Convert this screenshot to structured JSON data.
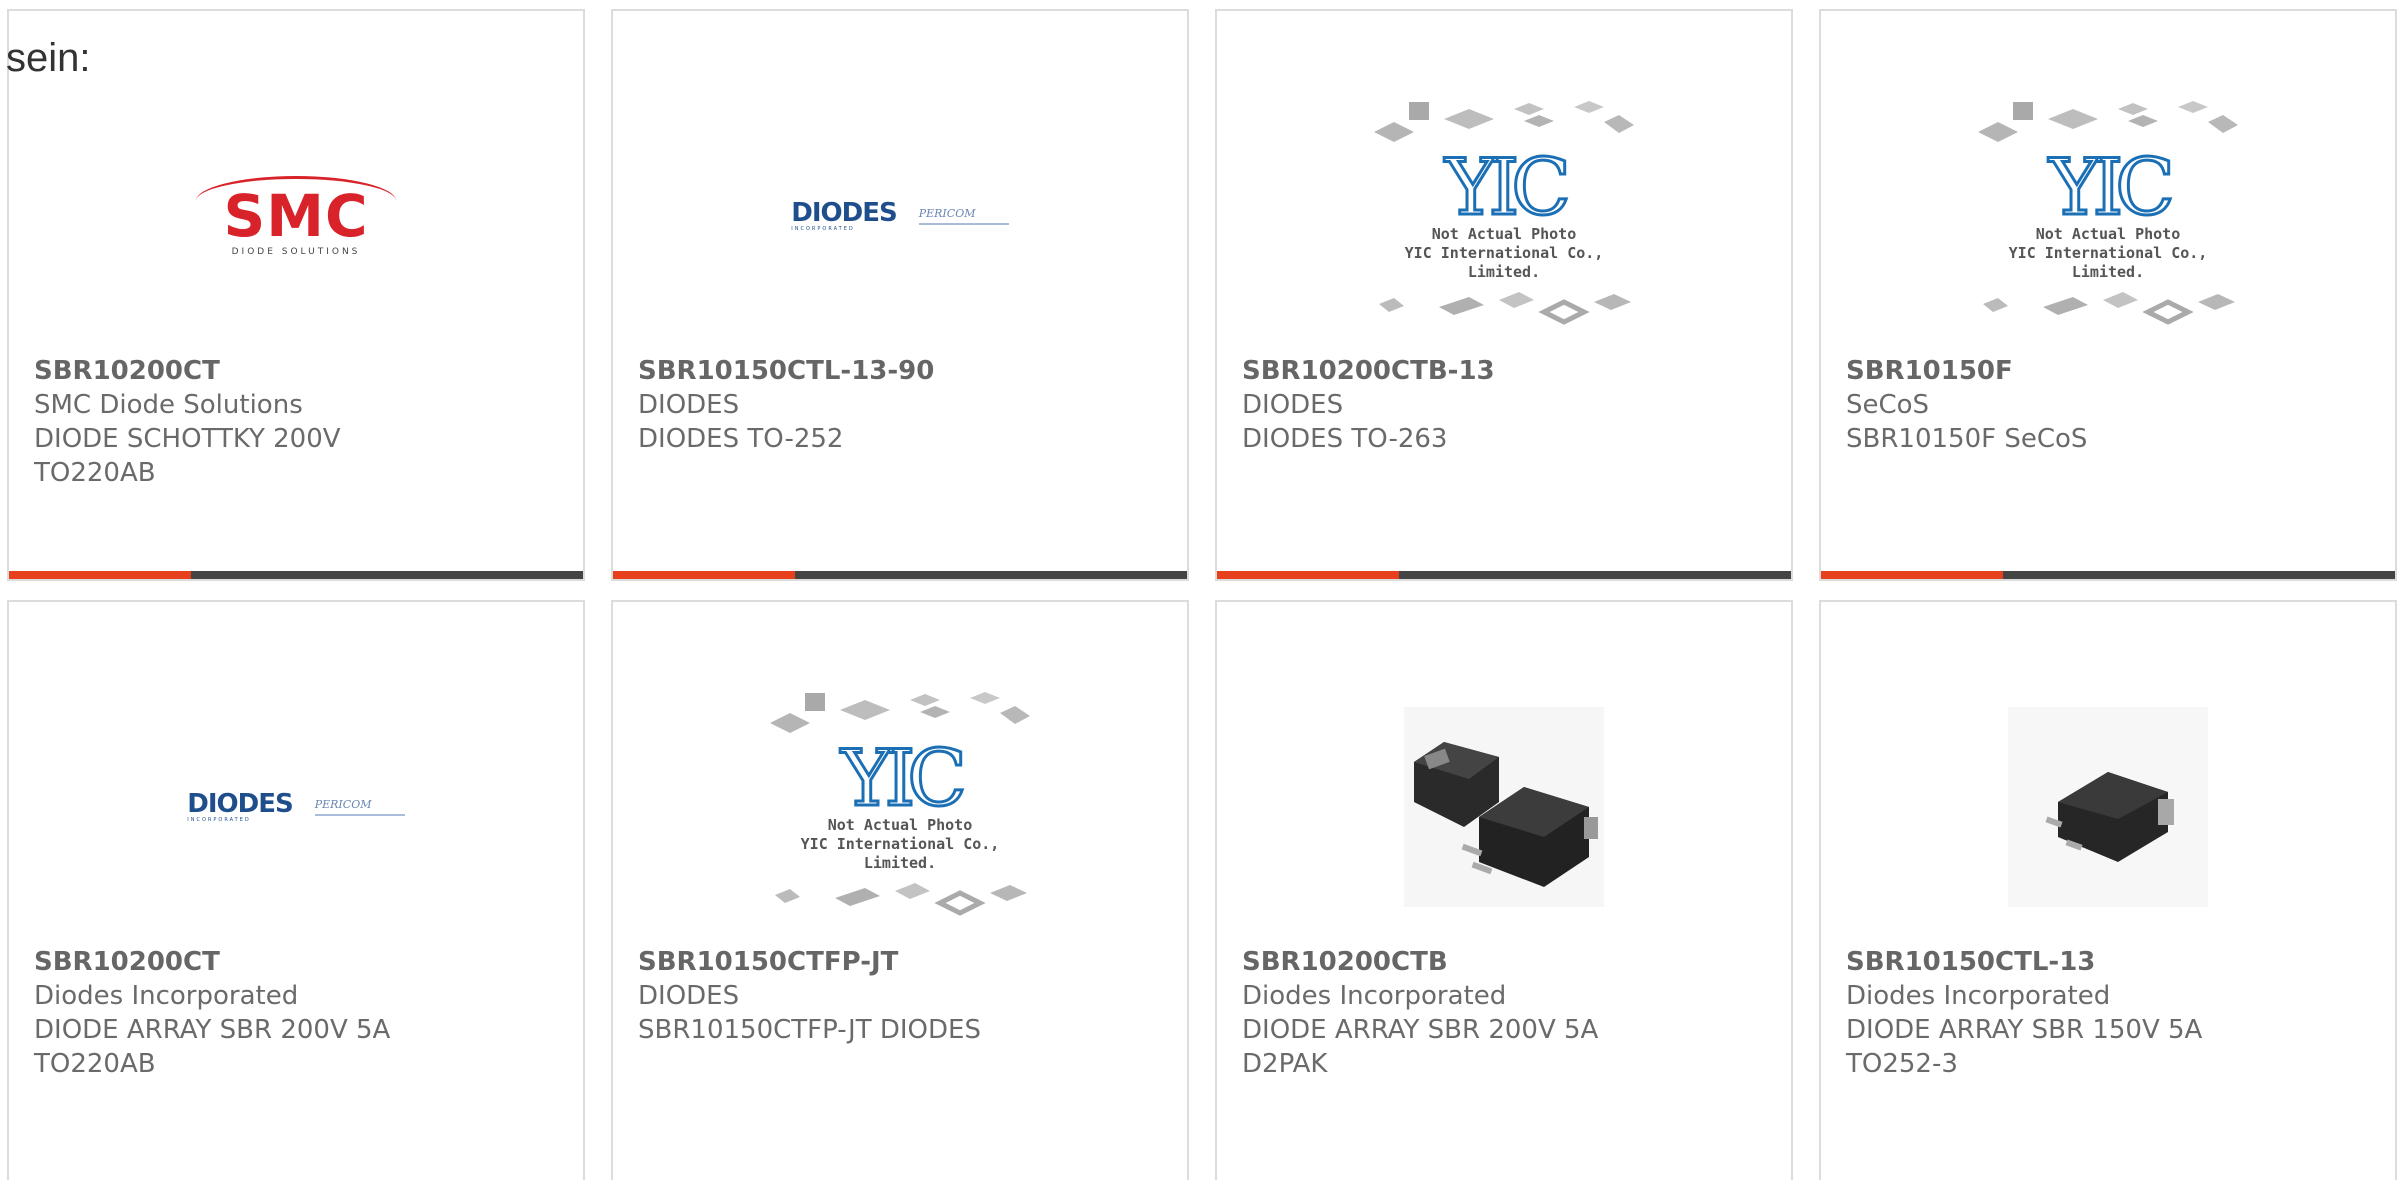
{
  "intro_text": "sein:",
  "colors": {
    "accent": "#e8401c",
    "bar": "#444444",
    "border": "#dcdcdc",
    "text": "#6a6a6a"
  },
  "logos": {
    "smc": {
      "word": "SMC",
      "sub": "DIODE SOLUTIONS"
    },
    "diodes": {
      "word": "DIODES",
      "tag": "INCORPORATED",
      "partner": "PERICOM"
    },
    "yic": {
      "mark": "YIC",
      "line1": "Not Actual Photo",
      "line2": "YIC International Co., Limited."
    }
  },
  "products": [
    {
      "part": "SBR10200CT",
      "maker": "SMC Diode Solutions",
      "desc": [
        "DIODE SCHOTTKY 200V",
        "TO220AB"
      ],
      "image": "smc-logo"
    },
    {
      "part": "SBR10150CTL-13-90",
      "maker": "DIODES",
      "desc": [
        "DIODES TO-252"
      ],
      "image": "diodes-logo"
    },
    {
      "part": "SBR10200CTB-13",
      "maker": "DIODES",
      "desc": [
        "DIODES TO-263"
      ],
      "image": "yic-placeholder"
    },
    {
      "part": "SBR10150F",
      "maker": "SeCoS",
      "desc": [
        "SBR10150F SeCoS"
      ],
      "image": "yic-placeholder"
    },
    {
      "part": "SBR10200CT",
      "maker": "Diodes Incorporated",
      "desc": [
        "DIODE ARRAY SBR 200V 5A",
        "TO220AB"
      ],
      "image": "diodes-logo"
    },
    {
      "part": "SBR10150CTFP-JT",
      "maker": "DIODES",
      "desc": [
        "SBR10150CTFP-JT DIODES"
      ],
      "image": "yic-placeholder"
    },
    {
      "part": "SBR10200CTB",
      "maker": "Diodes Incorporated",
      "desc": [
        "DIODE ARRAY SBR 200V 5A",
        "D2PAK"
      ],
      "image": "d2pak-photo"
    },
    {
      "part": "SBR10150CTL-13",
      "maker": "Diodes Incorporated",
      "desc": [
        "DIODE ARRAY SBR 150V 5A",
        "TO252-3"
      ],
      "image": "dpak-photo"
    }
  ]
}
